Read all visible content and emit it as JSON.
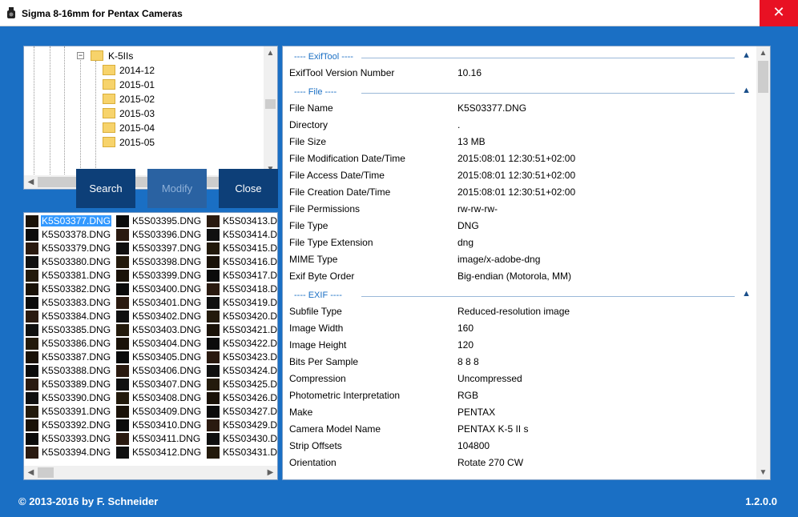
{
  "window": {
    "title": "Sigma 8-16mm for Pentax Cameras"
  },
  "tree": {
    "root": "K-5IIs",
    "folders": [
      "2014-12",
      "2015-01",
      "2015-02",
      "2015-03",
      "2015-04",
      "2015-05"
    ]
  },
  "buttons": {
    "search": "Search",
    "modify": "Modify",
    "close": "Close"
  },
  "files": {
    "selected": "K5S03377.DNG",
    "col1": [
      "K5S03377.DNG",
      "K5S03378.DNG",
      "K5S03379.DNG",
      "K5S03380.DNG",
      "K5S03381.DNG",
      "K5S03382.DNG",
      "K5S03383.DNG",
      "K5S03384.DNG",
      "K5S03385.DNG",
      "K5S03386.DNG",
      "K5S03387.DNG",
      "K5S03388.DNG",
      "K5S03389.DNG",
      "K5S03390.DNG",
      "K5S03391.DNG",
      "K5S03392.DNG",
      "K5S03393.DNG",
      "K5S03394.DNG"
    ],
    "col2": [
      "K5S03395.DNG",
      "K5S03396.DNG",
      "K5S03397.DNG",
      "K5S03398.DNG",
      "K5S03399.DNG",
      "K5S03400.DNG",
      "K5S03401.DNG",
      "K5S03402.DNG",
      "K5S03403.DNG",
      "K5S03404.DNG",
      "K5S03405.DNG",
      "K5S03406.DNG",
      "K5S03407.DNG",
      "K5S03408.DNG",
      "K5S03409.DNG",
      "K5S03410.DNG",
      "K5S03411.DNG",
      "K5S03412.DNG"
    ],
    "col3": [
      "K5S03413.D",
      "K5S03414.D",
      "K5S03415.D",
      "K5S03416.D",
      "K5S03417.D",
      "K5S03418.D",
      "K5S03419.D",
      "K5S03420.D",
      "K5S03421.D",
      "K5S03422.D",
      "K5S03423.D",
      "K5S03424.D",
      "K5S03425.D",
      "K5S03426.D",
      "K5S03427.D",
      "K5S03429.D",
      "K5S03430.D",
      "K5S03431.D"
    ]
  },
  "exif": {
    "groups": [
      {
        "title": "---- ExifTool ----",
        "rows": [
          {
            "k": "ExifTool Version Number",
            "v": "10.16"
          }
        ]
      },
      {
        "title": "---- File ----",
        "rows": [
          {
            "k": "File Name",
            "v": "K5S03377.DNG"
          },
          {
            "k": "Directory",
            "v": "."
          },
          {
            "k": "File Size",
            "v": "13 MB"
          },
          {
            "k": "File Modification Date/Time",
            "v": "2015:08:01 12:30:51+02:00"
          },
          {
            "k": "File Access Date/Time",
            "v": "2015:08:01 12:30:51+02:00"
          },
          {
            "k": "File Creation Date/Time",
            "v": "2015:08:01 12:30:51+02:00"
          },
          {
            "k": "File Permissions",
            "v": "rw-rw-rw-"
          },
          {
            "k": "File Type",
            "v": "DNG"
          },
          {
            "k": "File Type Extension",
            "v": "dng"
          },
          {
            "k": "MIME Type",
            "v": "image/x-adobe-dng"
          },
          {
            "k": "Exif Byte Order",
            "v": "Big-endian (Motorola, MM)"
          }
        ]
      },
      {
        "title": "---- EXIF ----",
        "rows": [
          {
            "k": "Subfile Type",
            "v": "Reduced-resolution image"
          },
          {
            "k": "Image Width",
            "v": "160"
          },
          {
            "k": "Image Height",
            "v": "120"
          },
          {
            "k": "Bits Per Sample",
            "v": "8 8 8"
          },
          {
            "k": "Compression",
            "v": "Uncompressed"
          },
          {
            "k": "Photometric Interpretation",
            "v": "RGB"
          },
          {
            "k": "Make",
            "v": "PENTAX"
          },
          {
            "k": "Camera Model Name",
            "v": "PENTAX K-5 II s"
          },
          {
            "k": "Strip Offsets",
            "v": "104800"
          },
          {
            "k": "Orientation",
            "v": "Rotate 270 CW"
          }
        ]
      }
    ]
  },
  "footer": {
    "copyright": "© 2013-2016 by F. Schneider",
    "version": "1.2.0.0"
  },
  "colors": {
    "window_bg": "#1a6fc4",
    "button_bg": "#0d3f78",
    "close_red": "#e81123",
    "selection": "#3399ff"
  }
}
